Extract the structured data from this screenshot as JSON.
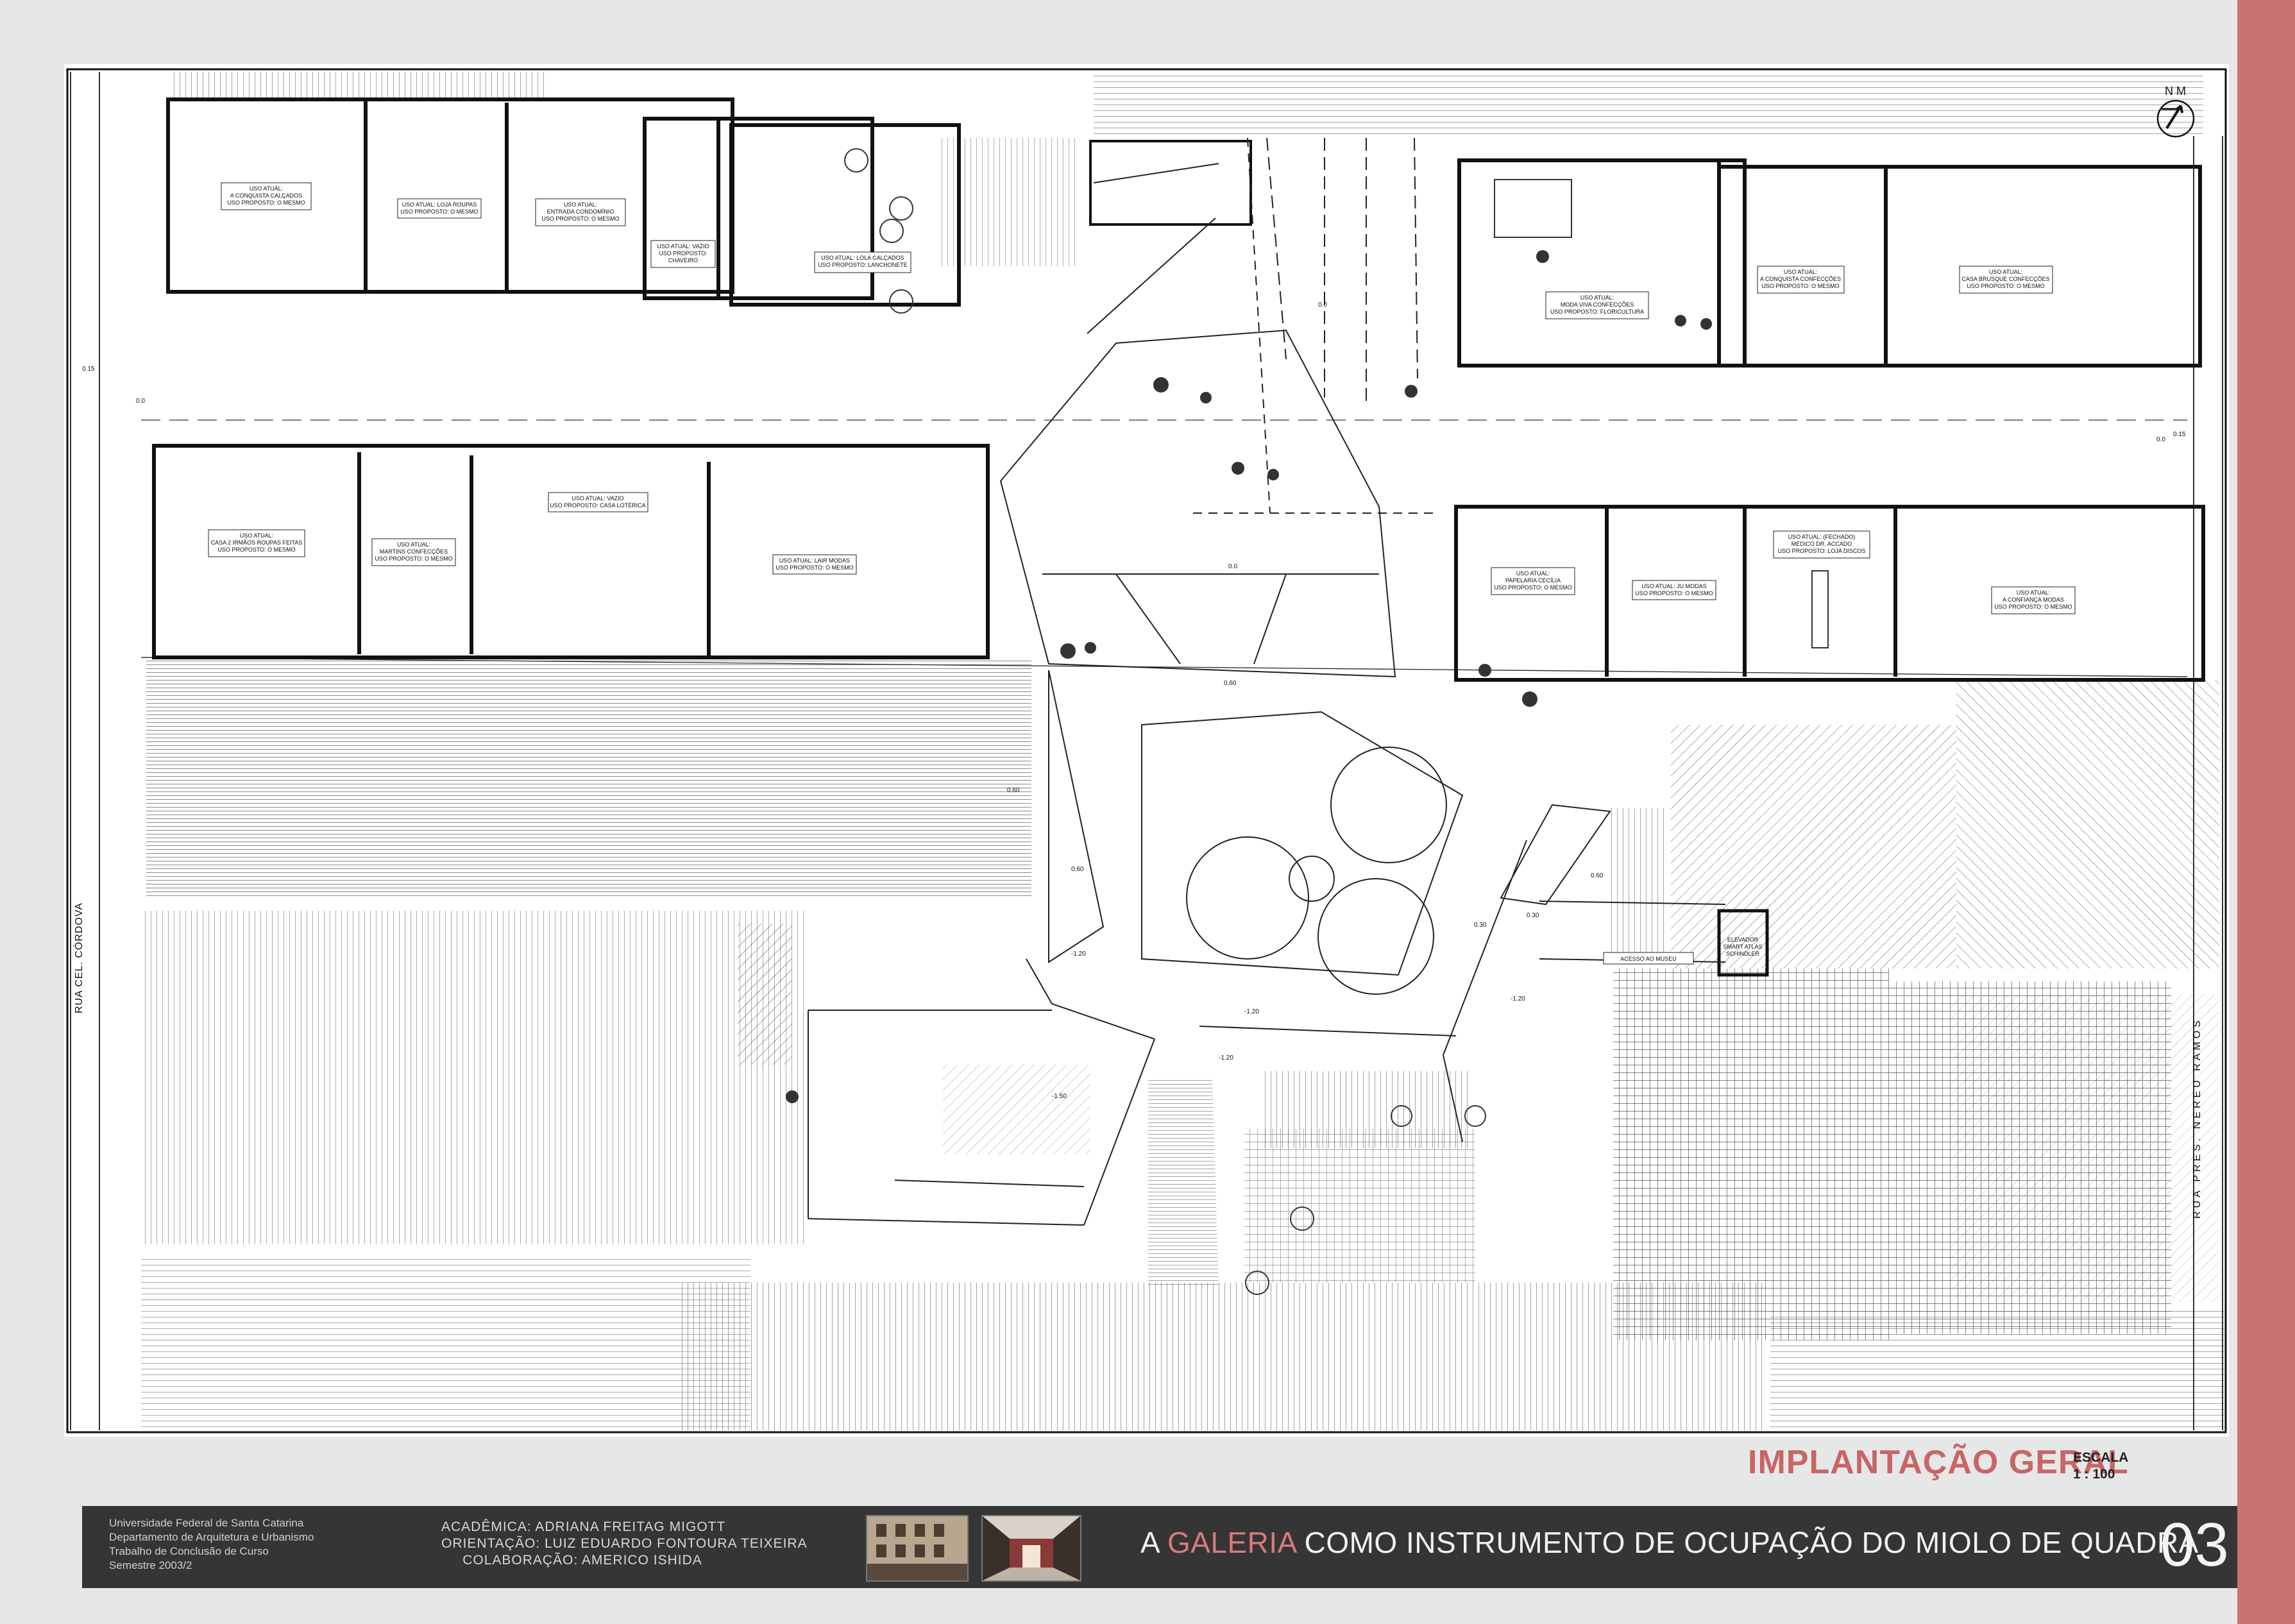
{
  "sheet": {
    "title": "IMPLANTAÇÃO GERAL",
    "scale_label": "ESCALA",
    "scale_value": "1 : 100",
    "north_label": "N M",
    "streets": {
      "left": "RUA CEL. CÓRDOVA",
      "right": "RUA PRES. NEREU RAMOS"
    }
  },
  "rooms": [
    {
      "id": "a",
      "lines": [
        "USO ATUAL:",
        "A CONQUISTA CALÇADOS",
        "USO PROPOSTO: O MESMO"
      ]
    },
    {
      "id": "b",
      "lines": [
        "USO ATUAL: LOJA ROUPAS",
        "USO PROPOSTO: O MESMO"
      ]
    },
    {
      "id": "c",
      "lines": [
        "USO ATUAL:",
        "ENTRADA CONDOMÍNIO",
        "USO PROPOSTO: O MESMO"
      ]
    },
    {
      "id": "d",
      "lines": [
        "USO ATUAL: VAZIO",
        "USO PROPOSTO:",
        "CHAVEIRO"
      ]
    },
    {
      "id": "e",
      "lines": [
        "USO ATUAL: LOLA CALÇADOS",
        "USO PROPOSTO: LANCHONETE"
      ]
    },
    {
      "id": "f",
      "lines": [
        "USO ATUAL:",
        "MODA VIVA CONFECÇÕES",
        "USO PROPOSTO: FLORICULTURA"
      ]
    },
    {
      "id": "g",
      "lines": [
        "USO ATUAL:",
        "A CONQUISTA CONFECÇÕES",
        "USO PROPOSTO: O MESMO"
      ]
    },
    {
      "id": "h",
      "lines": [
        "USO ATUAL:",
        "CASA BRUSQUE CONFECÇÕES",
        "USO PROPOSTO: O MESMO"
      ]
    },
    {
      "id": "i",
      "lines": [
        "USO ATUAL:",
        "CASA 2 IRMÃOS ROUPAS FEITAS",
        "USO PROPOSTO: O MESMO"
      ]
    },
    {
      "id": "j",
      "lines": [
        "USO ATUAL:",
        "MARTINS CONFECÇÕES",
        "USO PROPOSTO: O MESMO"
      ]
    },
    {
      "id": "k",
      "lines": [
        "USO ATUAL: VAZIO",
        "USO PROPOSTO: CASA LOTÉRICA"
      ]
    },
    {
      "id": "l",
      "lines": [
        "USO ATUAL: LAIR MODAS",
        "USO PROPOSTO: O MESMO"
      ]
    },
    {
      "id": "m",
      "lines": [
        "USO ATUAL:",
        "PAPELARIA CECÍLIA",
        "USO PROPOSTO: O MESMO"
      ]
    },
    {
      "id": "n",
      "lines": [
        "USO ATUAL: JU MODAS",
        "USO PROPOSTO: O MESMO"
      ]
    },
    {
      "id": "o",
      "lines": [
        "USO ATUAL: (FECHADO)",
        "MÉDICO DR. ACCADO",
        "USO PROPOSTO: LOJA DISCOS"
      ]
    },
    {
      "id": "p",
      "lines": [
        "USO ATUAL:",
        "A CONFIANÇA MODAS",
        "USO PROPOSTO: O MESMO"
      ]
    },
    {
      "id": "q",
      "lines": [
        "ELEVADOR",
        "SMART ATLAS",
        "SCHINDLER"
      ]
    },
    {
      "id": "r",
      "lines": [
        "ACESSO AO MUSEU"
      ]
    }
  ],
  "levels": [
    "0.15",
    "0.0",
    "0.15",
    "0.0",
    "0.0",
    "0.60",
    "0.60",
    "0.60",
    "0.60",
    "0.30",
    "0.30",
    "-1.20",
    "-1.20",
    "-1.20",
    "-1.50",
    "-1.20",
    "0.0"
  ],
  "footer": {
    "university": [
      "Universidade Federal de Santa Catarina",
      "Departamento de Arquitetura e Urbanismo",
      "Trabalho de Conclusão de Curso",
      "Semestre 2003/2"
    ],
    "credits": [
      "ACADÊMICA:  ADRIANA  FREITAG  MIGOTT",
      "ORIENTAÇÃO:  LUIZ  EDUARDO  FONTOURA  TEIXEIRA",
      "COLABORAÇÃO:  AMERICO  ISHIDA"
    ],
    "title_prefix": "A ",
    "title_accent": "GALERIA",
    "title_suffix": " COMO INSTRUMENTO DE OCUPAÇÃO DO MIOLO DE QUADRA",
    "page_number": "03"
  },
  "colors": {
    "accent": "#c96565",
    "sidebar": "#c97373",
    "footer_bg": "#353535"
  }
}
